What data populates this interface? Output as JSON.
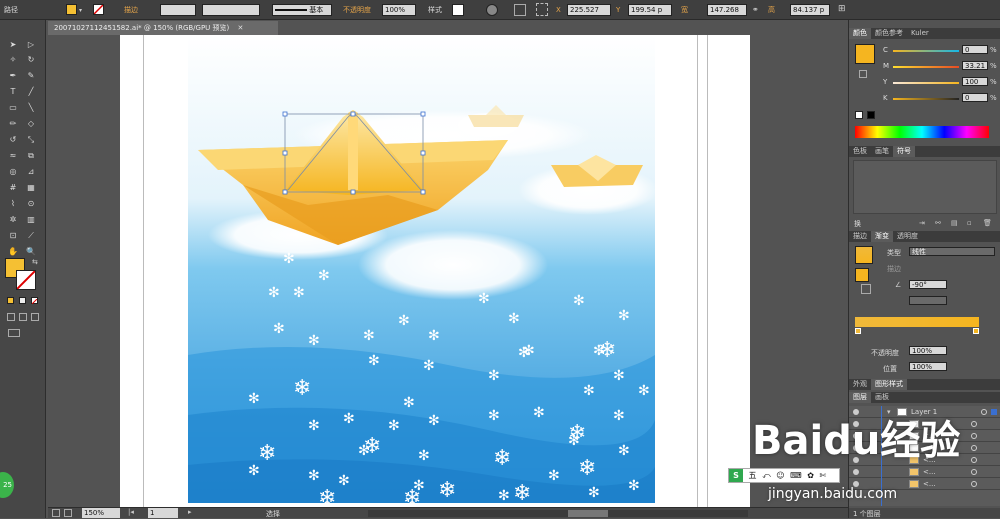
{
  "control_bar": {
    "object_type": "路径",
    "stroke_label": "描边",
    "stroke_profile": "基本",
    "opacity_label": "不透明度",
    "opacity_value": "100%",
    "style_label": "样式",
    "x_label": "X",
    "x_value": "225.527",
    "y_label": "Y",
    "y_value": "199.54 p",
    "w_label": "宽",
    "w_value": "147.268",
    "h_label": "高",
    "h_value": "84.137 p",
    "fill_color": "#F5C033"
  },
  "document": {
    "tab_title": "20071027112451582.ai* @ 150% (RGB/GPU 预览)"
  },
  "status_bar": {
    "zoom": "150%",
    "page": "1",
    "tool_name": "选择"
  },
  "color_panel": {
    "tabs": [
      "颜色",
      "颜色参考",
      "Kuler"
    ],
    "channels": [
      {
        "label": "C",
        "value": "0",
        "unit": "%"
      },
      {
        "label": "M",
        "value": "33.21",
        "unit": "%"
      },
      {
        "label": "Y",
        "value": "100",
        "unit": "%"
      },
      {
        "label": "K",
        "value": "0",
        "unit": "%"
      }
    ],
    "swatch_color": "#F5B520"
  },
  "swatch_panel": {
    "tabs": [
      "色板",
      "画笔",
      "符号"
    ],
    "footer_label": "换"
  },
  "gradient_panel": {
    "tabs": [
      "描边",
      "渐变",
      "透明度"
    ],
    "type_label": "类型",
    "type_value": "线性",
    "stroke_label": "描边",
    "angle_value": "-90°",
    "opacity_label": "不透明度",
    "opacity_value": "100%",
    "position_label": "位置",
    "position_value": "100%",
    "gradient_from": "#F0B93A",
    "gradient_to": "#F5B520"
  },
  "appearance_panel": {
    "tabs": [
      "外观",
      "图形样式"
    ]
  },
  "layers_panel": {
    "tabs": [
      "图层",
      "画板"
    ],
    "layer_name": "Layer 1",
    "sublayers": [
      "<...",
      "<...",
      "<...",
      "<...",
      "<...",
      "<..."
    ],
    "footer_label": "1 个图层"
  },
  "ime_toolbar": {
    "brand": "S",
    "mode": "五"
  },
  "watermark": {
    "brand": "Baidu经验",
    "url": "jingyan.baidu.com"
  },
  "badge": {
    "text": "25"
  }
}
